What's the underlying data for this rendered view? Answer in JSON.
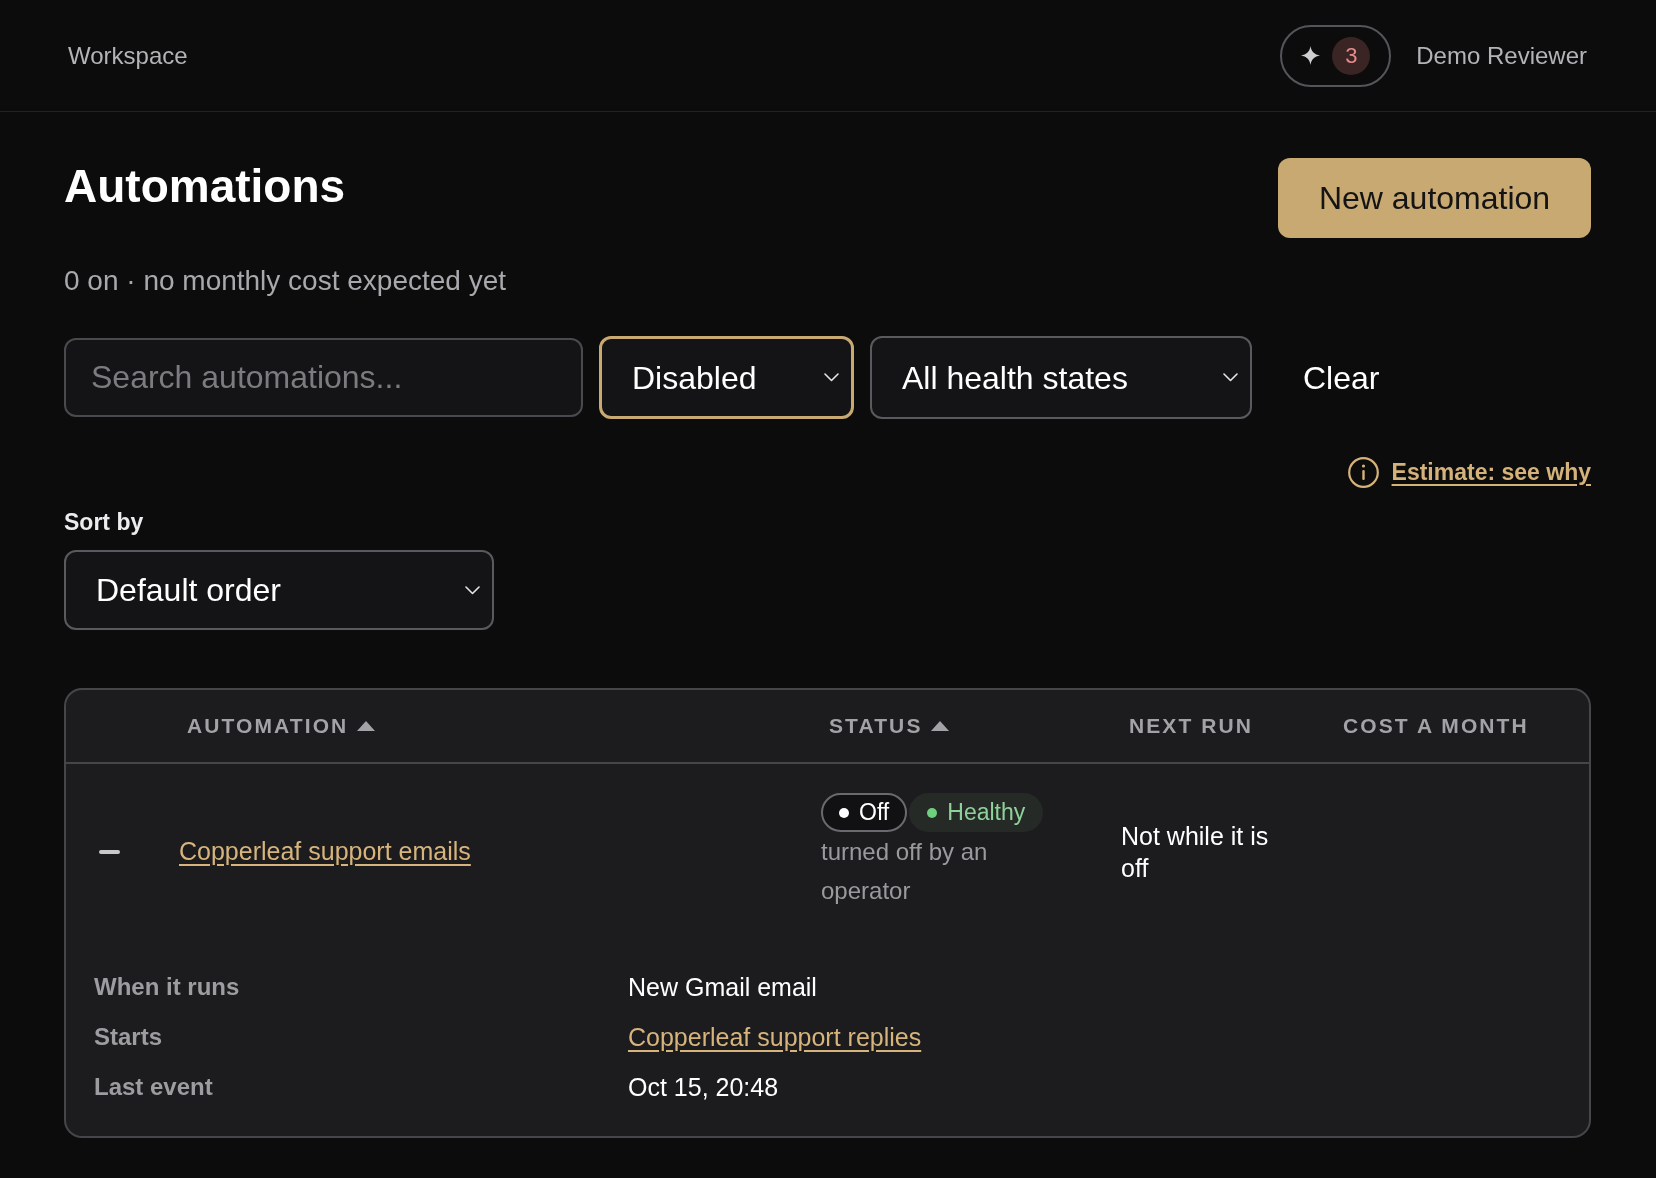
{
  "top_bar": {
    "workspace": "Workspace",
    "notifications": {
      "count": "3"
    },
    "user": "Demo Reviewer"
  },
  "page": {
    "title": "Automations",
    "primary_action": "New automation",
    "summary": "0 on · no monthly cost expected yet"
  },
  "filters": {
    "search": {
      "placeholder": "Search automations..."
    },
    "selects": [
      {
        "value": "Disabled",
        "focused": true
      },
      {
        "value": "All health states",
        "focused": false
      }
    ],
    "clear": "Clear"
  },
  "estimate_link": "Estimate: see why",
  "sort": {
    "label": "Sort by",
    "value": "Default order"
  },
  "table": {
    "columns": [
      {
        "label": "AUTOMATION",
        "sorted": true
      },
      {
        "label": "STATUS",
        "sorted": true
      },
      {
        "label": "NEXT RUN",
        "sorted": false
      },
      {
        "label": "COST A MONTH",
        "sorted": false
      }
    ],
    "rows": [
      {
        "expanded": true,
        "name": "Copperleaf support emails",
        "badges": [
          {
            "kind": "state",
            "label": "Off",
            "color": "#ffffff"
          },
          {
            "kind": "health",
            "label": "Healthy",
            "color": "#6fcf7f"
          }
        ],
        "status_note": "turned off by an operator",
        "next_run": "Not while it is off",
        "details": [
          {
            "kind": "text",
            "label": "When it runs",
            "value": "New Gmail email"
          },
          {
            "kind": "link",
            "label": "Starts",
            "value": "Copperleaf support replies"
          },
          {
            "kind": "text",
            "label": "Last event",
            "value": "Oct 15, 20:48"
          }
        ]
      }
    ]
  }
}
